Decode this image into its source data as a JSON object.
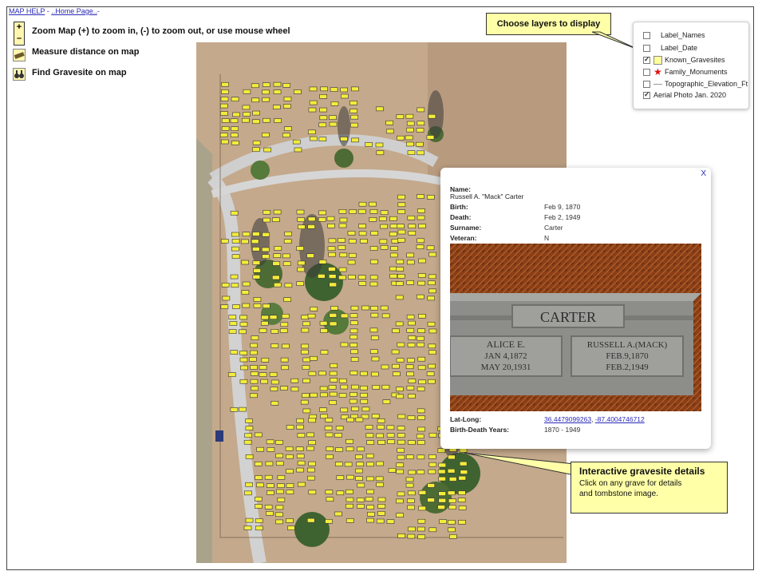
{
  "header": {
    "map_help_link": "MAP HELP",
    "separator": " - ",
    "home_link": "..Home Page..",
    "trailing": "-"
  },
  "tools": {
    "zoom_in_symbol": "+",
    "zoom_out_symbol": "–",
    "zoom_text": "Zoom Map  (+) to zoom in, (-) to zoom out, or use mouse wheel",
    "measure_text": "Measure distance on map",
    "find_text": "Find Gravesite on map"
  },
  "layers_callout": "Choose layers to display",
  "layers": [
    {
      "label": "Label_Names",
      "checked": false,
      "swatch": "dot"
    },
    {
      "label": "Label_Date",
      "checked": false,
      "swatch": "dot"
    },
    {
      "label": "Known_Gravesites",
      "checked": true,
      "swatch": "yellow-square"
    },
    {
      "label": "Family_Monuments",
      "checked": false,
      "swatch": "red-star"
    },
    {
      "label": "Topographic_Elevation_Ft",
      "checked": false,
      "swatch": "line"
    },
    {
      "label": "Aerial Photo Jan. 2020",
      "checked": true,
      "swatch": "none"
    }
  ],
  "popup": {
    "close_label": "X",
    "name_label": "Name:",
    "name_value": "Russell A. \"Mack\" Carter",
    "birth_label": "Birth:",
    "birth_value": "Feb 9, 1870",
    "death_label": "Death:",
    "death_value": "Feb 2, 1949",
    "surname_label": "Surname:",
    "surname_value": "Carter",
    "veteran_label": "Veteran:",
    "veteran_value": "N",
    "tombstone": {
      "family_name": "CARTER",
      "left_name": "ALICE E.",
      "left_birth": "JAN 4,1872",
      "left_death": "MAY 20,1931",
      "right_name": "RUSSELL A.(MACK)",
      "right_birth": "FEB.9,1870",
      "right_death": "FEB.2,1949"
    },
    "latlong_label": "Lat-Long:",
    "lat_value": "36.4479099263",
    "latlong_sep": ", ",
    "long_value": "-87.4004746712",
    "years_label": "Birth-Death Years:",
    "years_value": "1870 - 1949"
  },
  "details_callout": {
    "title": "Interactive gravesite details",
    "line1": "Click on any grave for details",
    "line2": "and tombstone image."
  },
  "colors": {
    "callout": "#ffffa8",
    "grave": "#f4ec3c",
    "link": "#2b2bb8"
  }
}
